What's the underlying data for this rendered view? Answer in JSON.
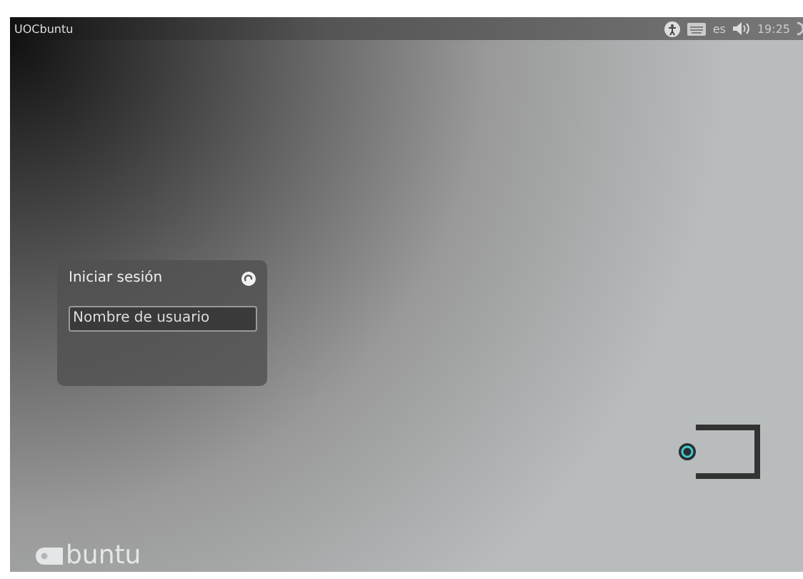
{
  "top_bar": {
    "title": "UOCbuntu",
    "keyboard_layout": "es",
    "time": "19:25"
  },
  "login": {
    "title": "Iniciar sesión",
    "username": {
      "placeholder": "Nombre de usuario"
    }
  },
  "logo": {
    "text": "buntu"
  }
}
